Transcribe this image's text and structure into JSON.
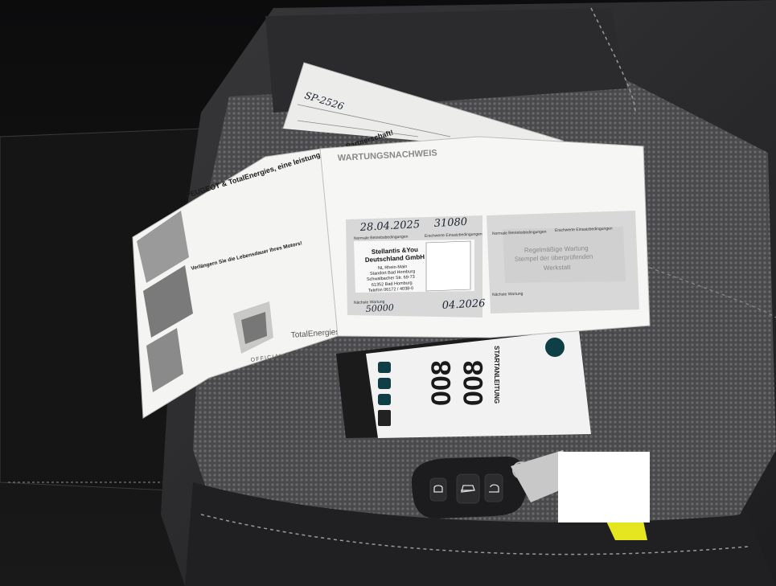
{
  "maintenance_booklet": {
    "heading": "WARTUNGSNACHWEIS",
    "partnership_heading": "PEUGEOT & TotalEnergies, eine leistungsstarke Partnerschaft!",
    "engine_heading": "Verlängern Sie die Lebensdauer Ihres Motors!",
    "official_partners_label": "OFFICIAL PARTNERS",
    "total_energies_logo": "TotalEnergies",
    "service_entry": {
      "date_handwritten": "28.04.2025",
      "km_handwritten": "31080",
      "regular_service_label": "Normale Betriebsbedingungen",
      "harsh_service_label": "Erschwerte Einsatzbedingungen",
      "next_service_label": "Nächste Wartung",
      "next_km_handwritten": "50000",
      "next_date_handwritten": "04.2026",
      "dealer_stamp": {
        "name_line1": "Stellantis &You",
        "name_line2": "Deutschland GmbH",
        "line3": "NL Rhein-Main",
        "line4": "Standort Bad Homburg",
        "line5": "Schwalbacher Str. 69-73",
        "line6": "61352 Bad Homburg",
        "line7": "Telefon 06172 / 4038-0"
      }
    },
    "empty_entry": {
      "regular_service_label": "Normale Betriebsbedingungen",
      "harsh_service_label": "Erschwerte Einsatzbedingungen",
      "stamp_placeholder_line1": "Regelmäßige Wartung",
      "stamp_placeholder_line2": "Stempel der überprüfenden",
      "stamp_placeholder_line3": "Werkstatt",
      "next_service_label": "Nächste Wartung"
    }
  },
  "back_sheet": {
    "handwritten_mark": "SP-2526"
  },
  "manual_box": {
    "model_label": "008",
    "model_label_second": "008",
    "vertical_title": "STARTANLEITUNG"
  },
  "colors": {
    "seat_dark": "#2a2a2c",
    "seat_light": "#5a5a5c",
    "paper": "#f4f4f2",
    "paper_shadow": "#c9c9c7",
    "stamp_box": "#dadada",
    "key_body": "#1c1c1e",
    "key_tag_yellow": "#e6e620",
    "redaction_white": "#ffffff"
  }
}
